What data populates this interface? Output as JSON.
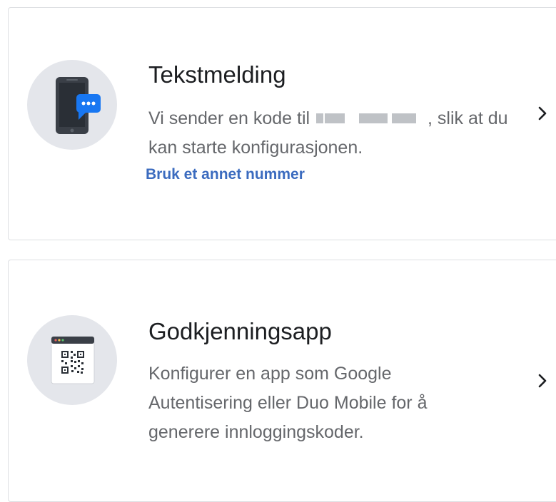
{
  "options": [
    {
      "title": "Tekstmelding",
      "description_prefix": "Vi sender en kode til",
      "description_suffix": ", slik at du kan starte konfigurasjonen.",
      "link_text": "Bruk et annet nummer",
      "icon": "phone-chat-icon",
      "chevron_icon": "chevron-right-icon"
    },
    {
      "title": "Godkjenningsapp",
      "description": "Konfigurer en app som Google Autentisering eller Duo Mobile for å generere innloggingskoder.",
      "icon": "qr-code-browser-icon",
      "chevron_icon": "chevron-right-icon"
    }
  ],
  "colors": {
    "card_border": "#dddfe2",
    "icon_background": "#e4e6eb",
    "title_text": "#1c1e21",
    "description_text": "#65676b",
    "link_text": "#3b6bbf",
    "chat_bubble": "#1877f2",
    "phone_body": "#3a3f47"
  }
}
